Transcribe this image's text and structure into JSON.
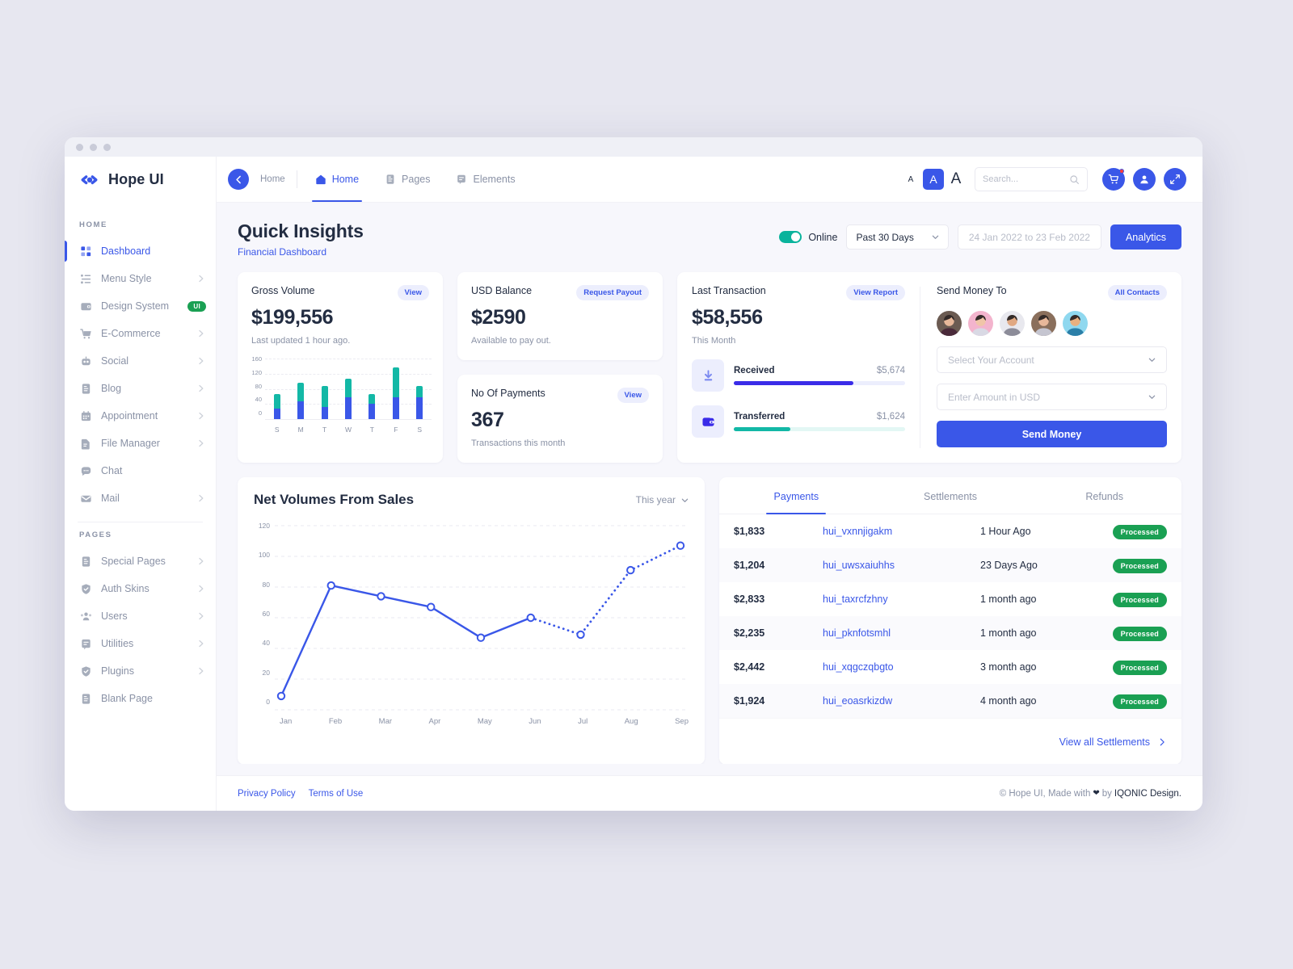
{
  "brand": {
    "name": "Hope UI",
    "logo_icon": "hope-logo-icon"
  },
  "sidebar": {
    "sections": [
      {
        "heading": "HOME",
        "items": [
          {
            "label": "Dashboard",
            "icon": "grid-icon",
            "active": true,
            "chevron": false,
            "badge": ""
          },
          {
            "label": "Menu Style",
            "icon": "list-icon",
            "active": false,
            "chevron": true,
            "badge": ""
          },
          {
            "label": "Design System",
            "icon": "palette-icon",
            "active": false,
            "chevron": false,
            "badge": "UI"
          },
          {
            "label": "E-Commerce",
            "icon": "cart-icon",
            "active": false,
            "chevron": true,
            "badge": ""
          },
          {
            "label": "Social",
            "icon": "robot-icon",
            "active": false,
            "chevron": true,
            "badge": ""
          },
          {
            "label": "Blog",
            "icon": "article-icon",
            "active": false,
            "chevron": true,
            "badge": ""
          },
          {
            "label": "Appointment",
            "icon": "calendar-icon",
            "active": false,
            "chevron": true,
            "badge": ""
          },
          {
            "label": "File Manager",
            "icon": "file-icon",
            "active": false,
            "chevron": true,
            "badge": ""
          },
          {
            "label": "Chat",
            "icon": "chat-icon",
            "active": false,
            "chevron": false,
            "badge": ""
          },
          {
            "label": "Mail",
            "icon": "envelope-icon",
            "active": false,
            "chevron": true,
            "badge": ""
          }
        ]
      },
      {
        "heading": "PAGES",
        "items": [
          {
            "label": "Special Pages",
            "icon": "article-icon",
            "active": false,
            "chevron": true,
            "badge": ""
          },
          {
            "label": "Auth Skins",
            "icon": "shield-icon",
            "active": false,
            "chevron": true,
            "badge": ""
          },
          {
            "label": "Users",
            "icon": "users-icon",
            "active": false,
            "chevron": true,
            "badge": ""
          },
          {
            "label": "Utilities",
            "icon": "bookmark-icon",
            "active": false,
            "chevron": true,
            "badge": ""
          },
          {
            "label": "Plugins",
            "icon": "shield-icon",
            "active": false,
            "chevron": true,
            "badge": ""
          },
          {
            "label": "Blank Page",
            "icon": "article-icon",
            "active": false,
            "chevron": false,
            "badge": ""
          }
        ]
      }
    ]
  },
  "topbar": {
    "back_icon": "arrow-left-icon",
    "breadcrumb": "Home",
    "tabs": [
      {
        "label": "Home",
        "icon": "home-icon",
        "active": true
      },
      {
        "label": "Pages",
        "icon": "pages-icon",
        "active": false
      },
      {
        "label": "Elements",
        "icon": "elements-icon",
        "active": false
      }
    ],
    "font_sizes": {
      "small": "A",
      "medium": "A",
      "large": "A",
      "selected": "medium"
    },
    "search": {
      "placeholder": "Search...",
      "value": "",
      "icon": "search-icon"
    },
    "actions": [
      {
        "name": "cart-button",
        "icon": "cart-icon",
        "has_notification": true
      },
      {
        "name": "account-button",
        "icon": "user-icon",
        "has_notification": false
      },
      {
        "name": "expand-button",
        "icon": "expand-icon",
        "has_notification": false
      }
    ]
  },
  "page": {
    "title": "Quick Insights",
    "subtitle": "Financial Dashboard",
    "status_toggle": {
      "label": "Online",
      "on": true
    },
    "range_select": {
      "value": "Past 30 Days"
    },
    "date_range": {
      "placeholder": "24 Jan 2022 to 23 Feb 2022",
      "value": ""
    },
    "analytics_button": "Analytics"
  },
  "cards": {
    "gross_volume": {
      "title": "Gross Volume",
      "action": "View",
      "amount": "$199,556",
      "note": "Last updated 1 hour ago."
    },
    "usd_balance": {
      "title": "USD Balance",
      "action": "Request Payout",
      "amount": "$2590",
      "note": "Available to pay out."
    },
    "no_of_payments": {
      "title": "No Of Payments",
      "action": "View",
      "amount": "367",
      "note": "Transactions this month"
    },
    "last_transaction": {
      "title": "Last Transaction",
      "action": "View Report",
      "amount": "$58,556",
      "note": "This Month",
      "rows": [
        {
          "label": "Received",
          "value": "$5,674",
          "percent": 70,
          "color": "#3a2ce8",
          "track": "#eceefd",
          "icon": "download-arrow-icon"
        },
        {
          "label": "Transferred",
          "value": "$1,624",
          "percent": 33,
          "color": "#13b8a6",
          "track": "#e3f7f4",
          "icon": "wallet-icon"
        }
      ]
    },
    "send_money": {
      "title": "Send Money To",
      "action": "All Contacts",
      "contacts": [
        {
          "name": "contact-1",
          "bg": "#6b5b52",
          "shirt": "#4a2a3a",
          "skin": "#e8b89a"
        },
        {
          "name": "contact-2",
          "bg": "#f3b4cd",
          "shirt": "#d9d9e4",
          "skin": "#f0c5a8"
        },
        {
          "name": "contact-3",
          "bg": "#e8e8ee",
          "shirt": "#8c8c99",
          "skin": "#e0a882"
        },
        {
          "name": "contact-4",
          "bg": "#8a6f5c",
          "shirt": "#c5c5d0",
          "skin": "#e8b89a"
        },
        {
          "name": "contact-5",
          "bg": "#8fd8ef",
          "shirt": "#2b7fa8",
          "skin": "#e8b07f"
        }
      ],
      "account_field": {
        "placeholder": "Select Your Account",
        "value": ""
      },
      "amount_field": {
        "placeholder": "Enter Amount in USD",
        "value": ""
      },
      "submit": "Send Money"
    }
  },
  "net_volumes": {
    "title": "Net Volumes From Sales",
    "range": "This year"
  },
  "chart_data": [
    {
      "type": "bar",
      "title": "Gross Volume",
      "categories": [
        "S",
        "M",
        "T",
        "W",
        "T",
        "F",
        "S"
      ],
      "series": [
        {
          "name": "Base",
          "color": "#3a57e8",
          "values": [
            27,
            47,
            32,
            57,
            39,
            57,
            57
          ]
        },
        {
          "name": "Upper",
          "color": "#13b8a6",
          "values": [
            38,
            48,
            54,
            49,
            27,
            78,
            30
          ]
        }
      ],
      "stacked": true,
      "totals": [
        65,
        95,
        86,
        106,
        66,
        135,
        87
      ],
      "yticks": [
        0,
        40,
        80,
        120,
        160
      ],
      "ylim": [
        0,
        160
      ],
      "xlabel": "",
      "ylabel": "",
      "grid": true,
      "legend": "none"
    },
    {
      "type": "line",
      "title": "Net Volumes From Sales",
      "x": [
        "Jan",
        "Feb",
        "Mar",
        "Apr",
        "May",
        "Jun",
        "Jul",
        "Aug",
        "Sep"
      ],
      "series": [
        {
          "name": "Net Volume",
          "color": "#3a57e8",
          "values": [
            9,
            81,
            74,
            67,
            47,
            60,
            49,
            91,
            107
          ],
          "solid_until_index": 5,
          "dashed_from_index": 5
        }
      ],
      "yticks": [
        0,
        20,
        40,
        60,
        80,
        100,
        120
      ],
      "ylim": [
        0,
        120
      ],
      "xlabel": "",
      "ylabel": "",
      "grid": true,
      "legend": "none"
    }
  ],
  "transactions": {
    "tabs": [
      {
        "label": "Payments",
        "active": true
      },
      {
        "label": "Settlements",
        "active": false
      },
      {
        "label": "Refunds",
        "active": false
      }
    ],
    "rows": [
      {
        "amount": "$1,833",
        "id": "hui_vxnnjigakm",
        "when": "1 Hour Ago",
        "status": "Processed"
      },
      {
        "amount": "$1,204",
        "id": "hui_uwsxaiuhhs",
        "when": "23 Days Ago",
        "status": "Processed"
      },
      {
        "amount": "$2,833",
        "id": "hui_taxrcfzhny",
        "when": "1 month ago",
        "status": "Processed"
      },
      {
        "amount": "$2,235",
        "id": "hui_pknfotsmhl",
        "when": "1 month ago",
        "status": "Processed"
      },
      {
        "amount": "$2,442",
        "id": "hui_xqgczqbgto",
        "when": "3 month ago",
        "status": "Processed"
      },
      {
        "amount": "$1,924",
        "id": "hui_eoasrkizdw",
        "when": "4 month ago",
        "status": "Processed"
      }
    ],
    "footer_link": "View all Settlements"
  },
  "footer": {
    "links": [
      "Privacy Policy",
      "Terms of Use"
    ],
    "copyright_prefix": "© Hope UI, Made with",
    "heart_icon": "heart-icon",
    "copyright_suffix": "by",
    "company": "IQONIC Design."
  },
  "colors": {
    "primary": "#3a57e8",
    "teal": "#13b8a6",
    "green": "#1aa053",
    "muted": "#8a92a6",
    "dark": "#232d42"
  }
}
